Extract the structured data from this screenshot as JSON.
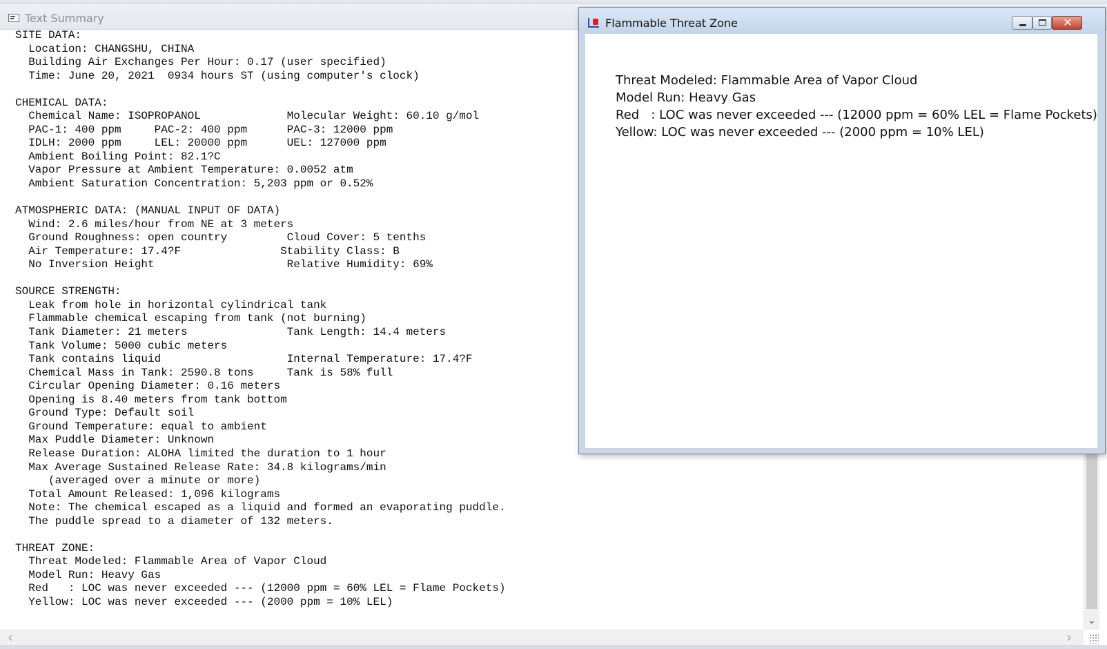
{
  "text_summary": {
    "title": "Text Summary",
    "lines": [
      "SITE DATA:",
      "  Location: CHANGSHU, CHINA",
      "  Building Air Exchanges Per Hour: 0.17 (user specified)",
      "  Time: June 20, 2021  0934 hours ST (using computer's clock)",
      "",
      "CHEMICAL DATA:",
      "  Chemical Name: ISOPROPANOL             Molecular Weight: 60.10 g/mol",
      "  PAC-1: 400 ppm     PAC-2: 400 ppm      PAC-3: 12000 ppm",
      "  IDLH: 2000 ppm     LEL: 20000 ppm      UEL: 127000 ppm",
      "  Ambient Boiling Point: 82.1?C",
      "  Vapor Pressure at Ambient Temperature: 0.0052 atm",
      "  Ambient Saturation Concentration: 5,203 ppm or 0.52%",
      "",
      "ATMOSPHERIC DATA: (MANUAL INPUT OF DATA)",
      "  Wind: 2.6 miles/hour from NE at 3 meters",
      "  Ground Roughness: open country         Cloud Cover: 5 tenths",
      "  Air Temperature: 17.4?F               Stability Class: B",
      "  No Inversion Height                    Relative Humidity: 69%",
      "",
      "SOURCE STRENGTH:",
      "  Leak from hole in horizontal cylindrical tank",
      "  Flammable chemical escaping from tank (not burning)",
      "  Tank Diameter: 21 meters               Tank Length: 14.4 meters",
      "  Tank Volume: 5000 cubic meters",
      "  Tank contains liquid                   Internal Temperature: 17.4?F",
      "  Chemical Mass in Tank: 2590.8 tons     Tank is 58% full",
      "  Circular Opening Diameter: 0.16 meters",
      "  Opening is 8.40 meters from tank bottom",
      "  Ground Type: Default soil",
      "  Ground Temperature: equal to ambient",
      "  Max Puddle Diameter: Unknown",
      "  Release Duration: ALOHA limited the duration to 1 hour",
      "  Max Average Sustained Release Rate: 34.8 kilograms/min",
      "     (averaged over a minute or more)",
      "  Total Amount Released: 1,096 kilograms",
      "  Note: The chemical escaped as a liquid and formed an evaporating puddle.",
      "  The puddle spread to a diameter of 132 meters.",
      "",
      "THREAT ZONE:",
      "  Threat Modeled: Flammable Area of Vapor Cloud",
      "  Model Run: Heavy Gas",
      "  Red   : LOC was never exceeded --- (12000 ppm = 60% LEL = Flame Pockets)",
      "  Yellow: LOC was never exceeded --- (2000 ppm = 10% LEL)"
    ]
  },
  "threat_window": {
    "title": "Flammable Threat Zone",
    "lines": [
      "Threat Modeled: Flammable Area of Vapor Cloud",
      "Model Run: Heavy Gas",
      "Red   : LOC was never exceeded --- (12000 ppm = 60% LEL = Flame Pockets)",
      "Yellow: LOC was never exceeded --- (2000 ppm = 10% LEL)"
    ],
    "close_glyph": "✕"
  },
  "scroll": {
    "down_arrow": "⌄",
    "left_arrow": "‹",
    "right_arrow": "›"
  },
  "icons": {
    "text_summary_icon": "document-icon",
    "threat_icon": "flame-chart-icon"
  }
}
